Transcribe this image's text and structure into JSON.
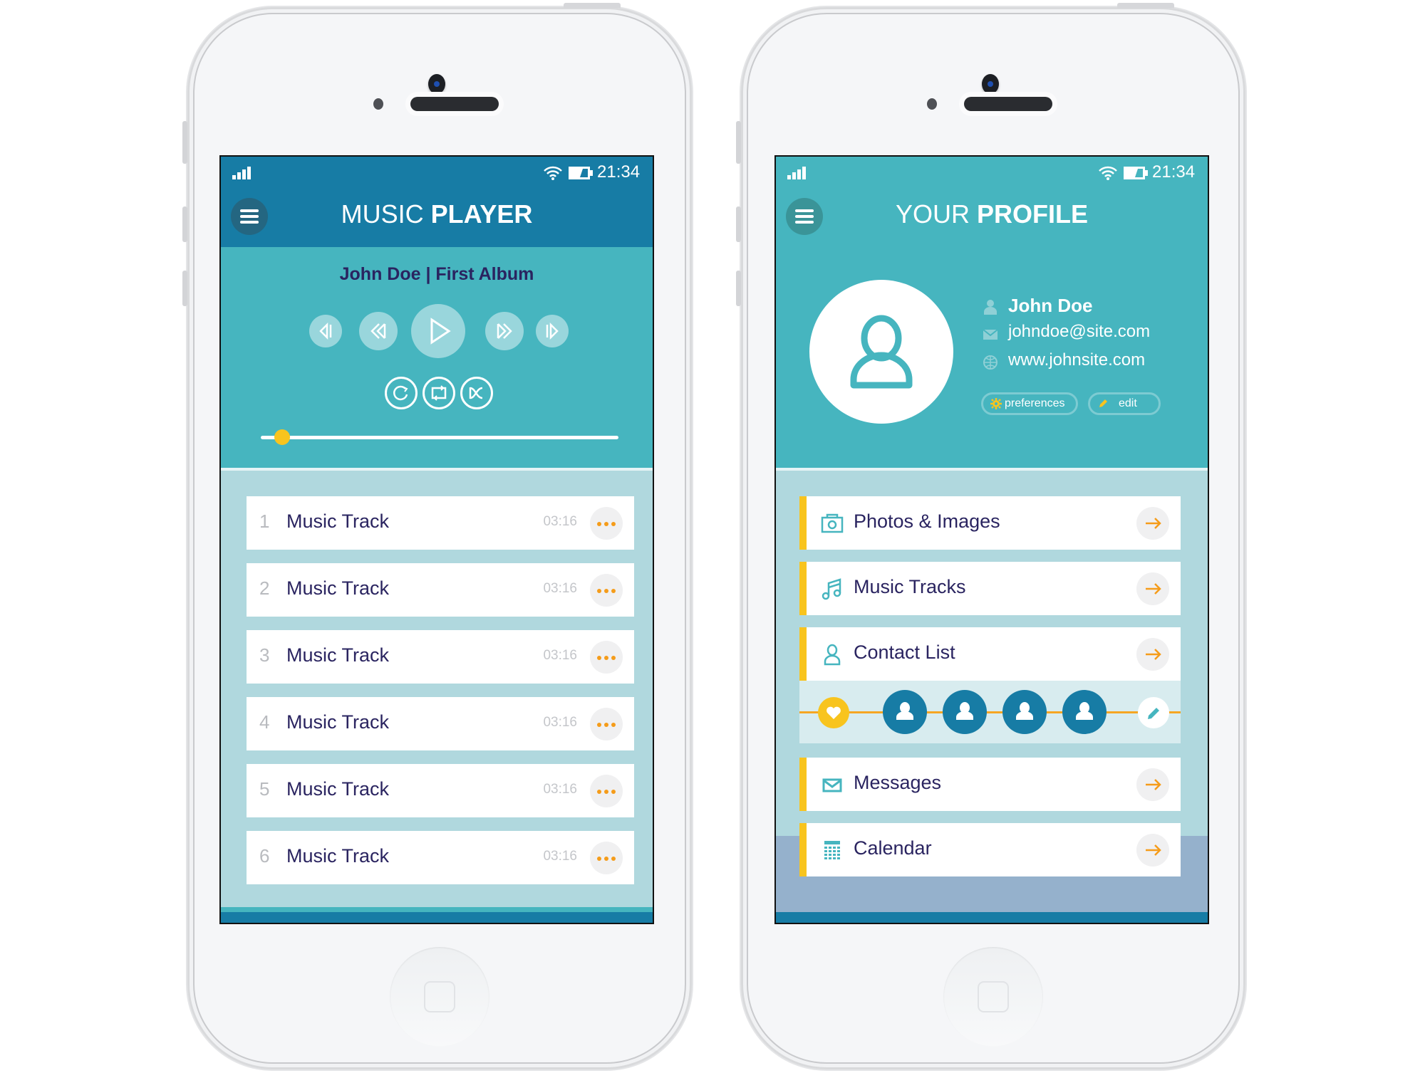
{
  "status_bar": {
    "time": "21:34",
    "signal_icon": "signal-bars-icon",
    "wifi_icon": "wifi-icon",
    "battery_icon": "battery-icon"
  },
  "music_player": {
    "title_light": "MUSIC",
    "title_bold": "PLAYER",
    "menu_icon": "hamburger-menu-icon",
    "album_title": "John Doe | First Album",
    "controls": [
      "previous-track",
      "rewind",
      "play",
      "fast-forward",
      "next-track"
    ],
    "modes": [
      "replay",
      "repeat",
      "shuffle"
    ],
    "progress": 0.06,
    "tracks": [
      {
        "num": "1",
        "name": "Music Track",
        "duration": "03:16"
      },
      {
        "num": "2",
        "name": "Music Track",
        "duration": "03:16"
      },
      {
        "num": "3",
        "name": "Music Track",
        "duration": "03:16"
      },
      {
        "num": "4",
        "name": "Music Track",
        "duration": "03:16"
      },
      {
        "num": "5",
        "name": "Music Track",
        "duration": "03:16"
      },
      {
        "num": "6",
        "name": "Music Track",
        "duration": "03:16"
      }
    ]
  },
  "profile": {
    "title_light": "YOUR",
    "title_bold": "PROFILE",
    "name": "John Doe",
    "email": "johndoe@site.com",
    "website": "www.johnsite.com",
    "preferences_label": "preferences",
    "edit_label": "edit",
    "menu": [
      {
        "label": "Photos & Images",
        "icon": "camera-icon"
      },
      {
        "label": "Music Tracks",
        "icon": "music-note-icon"
      },
      {
        "label": "Contact List",
        "icon": "person-icon"
      },
      {
        "label": "Messages",
        "icon": "envelope-icon"
      },
      {
        "label": "Calendar",
        "icon": "calendar-icon"
      }
    ],
    "contacts_count": 4
  },
  "colors": {
    "dark_blue": "#177ca5",
    "teal": "#46b5bf",
    "light_blue": "#b0d8de",
    "accent_yellow": "#f8c41e",
    "accent_orange": "#f59c1a",
    "text_navy": "#2a2460"
  }
}
